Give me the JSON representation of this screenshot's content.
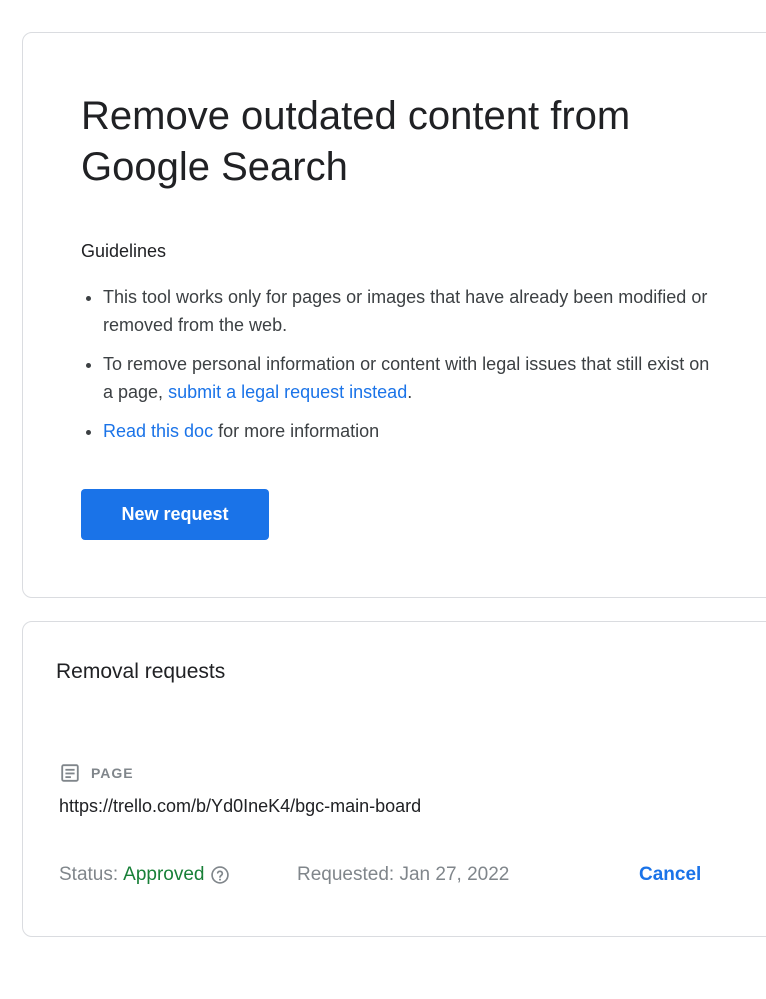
{
  "intro": {
    "title": "Remove outdated content from Google Search",
    "guidelines_heading": "Guidelines",
    "guidelines": [
      {
        "text": "This tool works only for pages or images that have already been modified or removed from the web."
      },
      {
        "prefix": "To remove personal information or content with legal issues that still exist on a page, ",
        "link": "submit a legal request instead",
        "suffix": "."
      },
      {
        "link": "Read this doc",
        "suffix": " for more information"
      }
    ],
    "new_request_label": "New request"
  },
  "removal_requests": {
    "title": "Removal requests",
    "items": [
      {
        "type_icon": "document-icon",
        "type_label": "PAGE",
        "url": "https://trello.com/b/Yd0IneK4/bgc-main-board",
        "status_label": "Status:",
        "status_value": "Approved",
        "requested": "Requested: Jan 27, 2022",
        "cancel_label": "Cancel"
      }
    ]
  },
  "colors": {
    "accent": "#1a73e8",
    "approved": "#188038",
    "muted": "#80868b"
  }
}
